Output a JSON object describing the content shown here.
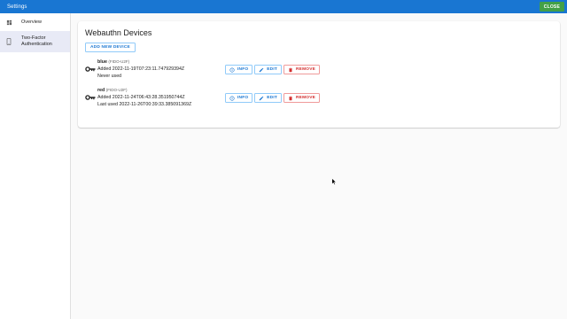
{
  "appbar": {
    "title": "Settings",
    "close_label": "CLOSE"
  },
  "sidebar": {
    "items": [
      {
        "label": "Overview",
        "icon": "dashboard-icon"
      },
      {
        "label": "Two-Factor\nAuthentication",
        "icon": "phone-icon"
      }
    ]
  },
  "main": {
    "title": "Webauthn Devices",
    "add_label": "ADD NEW DEVICE",
    "devices": [
      {
        "name": "blue",
        "type": "(FIDO-U2F)",
        "added": "Added 2022-11-19T07:23:11.747929394Z",
        "usage": "Never used"
      },
      {
        "name": "red",
        "type": "(FIDO-U2F)",
        "added": "Added 2022-11-24T06:43:28.351950744Z",
        "usage": "Last used 2022-11-26T00:39:33.385091369Z"
      }
    ],
    "actions": {
      "info": "INFO",
      "edit": "EDIT",
      "remove": "REMOVE"
    }
  },
  "colors": {
    "primary": "#1976d2",
    "close_button": "#43a047",
    "danger": "#d32f2f",
    "selected_nav": "#e8eaf6"
  }
}
